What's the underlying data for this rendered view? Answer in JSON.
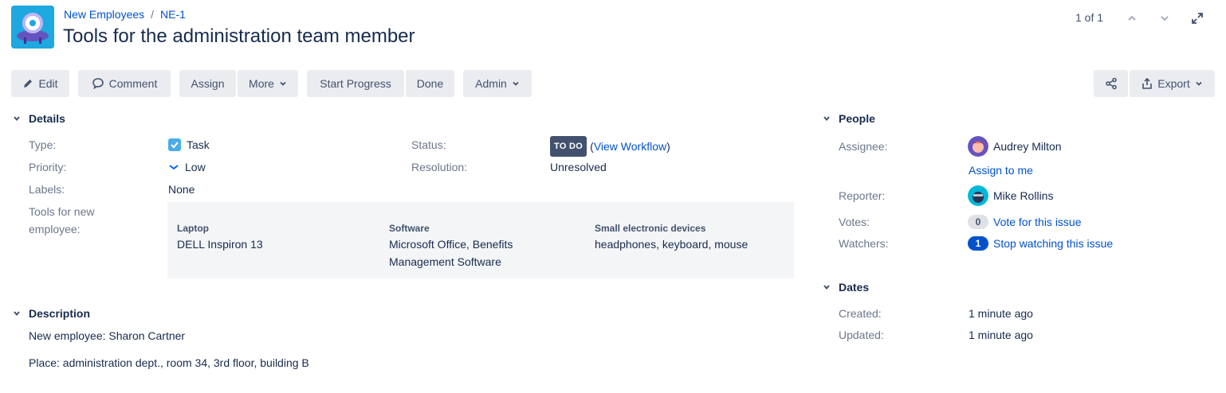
{
  "breadcrumb": {
    "project": "New Employees",
    "separator": "/",
    "issue_key": "NE-1"
  },
  "issue": {
    "summary": "Tools for the administration team member"
  },
  "pager": {
    "text": "1 of 1"
  },
  "toolbar": {
    "edit": "Edit",
    "comment": "Comment",
    "assign": "Assign",
    "more": "More",
    "start_progress": "Start Progress",
    "done": "Done",
    "admin": "Admin",
    "export": "Export"
  },
  "details": {
    "title": "Details",
    "type_label": "Type:",
    "type_value": "Task",
    "priority_label": "Priority:",
    "priority_value": "Low",
    "labels_label": "Labels:",
    "labels_value": "None",
    "tools_label_line1": "Tools for new",
    "tools_label_line2": "employee:",
    "status_label": "Status:",
    "status_value": "TO DO",
    "view_workflow_open": "(",
    "view_workflow": "View Workflow",
    "view_workflow_close": ")",
    "resolution_label": "Resolution:",
    "resolution_value": "Unresolved",
    "tools": [
      {
        "header": "Laptop",
        "value_line1": "DELL Inspiron 13",
        "value_line2": ""
      },
      {
        "header": "Software",
        "value_line1": "Microsoft Office, Benefits",
        "value_line2": "Management Software"
      },
      {
        "header": "Small electronic devices",
        "value_line1": "headphones, keyboard, mouse",
        "value_line2": ""
      }
    ]
  },
  "description": {
    "title": "Description",
    "line1": "New employee: Sharon Cartner",
    "line2": "Place: administration dept., room 34, 3rd floor, building B"
  },
  "people": {
    "title": "People",
    "assignee_label": "Assignee:",
    "assignee_name": "Audrey Milton",
    "assign_to_me": "Assign to me",
    "reporter_label": "Reporter:",
    "reporter_name": "Mike Rollins",
    "votes_label": "Votes:",
    "votes_count": "0",
    "vote_link": "Vote for this issue",
    "watchers_label": "Watchers:",
    "watchers_count": "1",
    "watch_link": "Stop watching this issue"
  },
  "dates": {
    "title": "Dates",
    "created_label": "Created:",
    "created_value": "1 minute ago",
    "updated_label": "Updated:",
    "updated_value": "1 minute ago"
  },
  "colors": {
    "link": "#0052cc",
    "button_bg": "#ebecf0",
    "lozenge_bg": "#42526e",
    "project_avatar_bg": "#1ea8e0"
  },
  "icons": {
    "project_avatar": "robot-avatar-icon",
    "edit": "pencil-icon",
    "comment": "comment-bubble-icon",
    "share": "share-icon",
    "export": "export-icon",
    "task": "task-checkbox-icon",
    "priority": "priority-low-icon"
  }
}
